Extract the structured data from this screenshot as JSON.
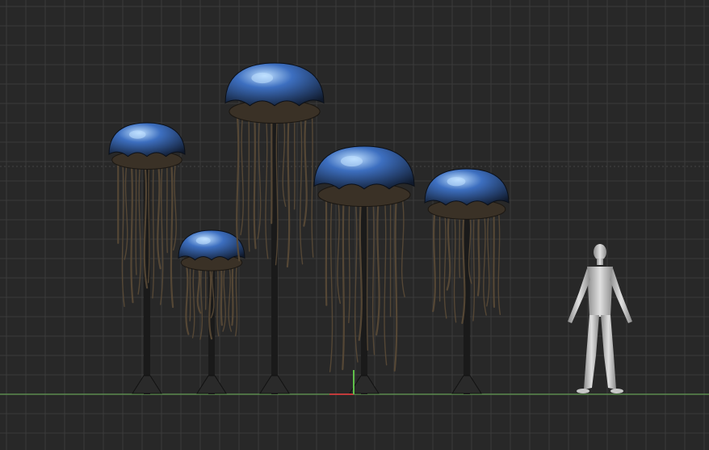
{
  "viewport": {
    "background": "#282828",
    "grid_color": "#3a3a3a",
    "grid_major_color": "#444444",
    "ground_line_color": "#5b8a4e",
    "axis_x_color": "#c23b3b",
    "axis_y_color": "#5fbf4a"
  },
  "scene": {
    "objects": [
      {
        "name": "jellyfish-lamp-1",
        "kind": "jellyfish"
      },
      {
        "name": "jellyfish-lamp-2",
        "kind": "jellyfish"
      },
      {
        "name": "jellyfish-lamp-3",
        "kind": "jellyfish"
      },
      {
        "name": "jellyfish-lamp-4",
        "kind": "jellyfish"
      },
      {
        "name": "jellyfish-lamp-5",
        "kind": "jellyfish"
      },
      {
        "name": "human-scale-reference",
        "kind": "human"
      }
    ],
    "materials": {
      "bell_highlight": "#bfe0ff",
      "bell_mid": "#3d6fc0",
      "bell_dark": "#101a2c",
      "tentacle": "#5a4a36",
      "pole": "#1a1a1a",
      "human": "#c8c8c8"
    }
  }
}
